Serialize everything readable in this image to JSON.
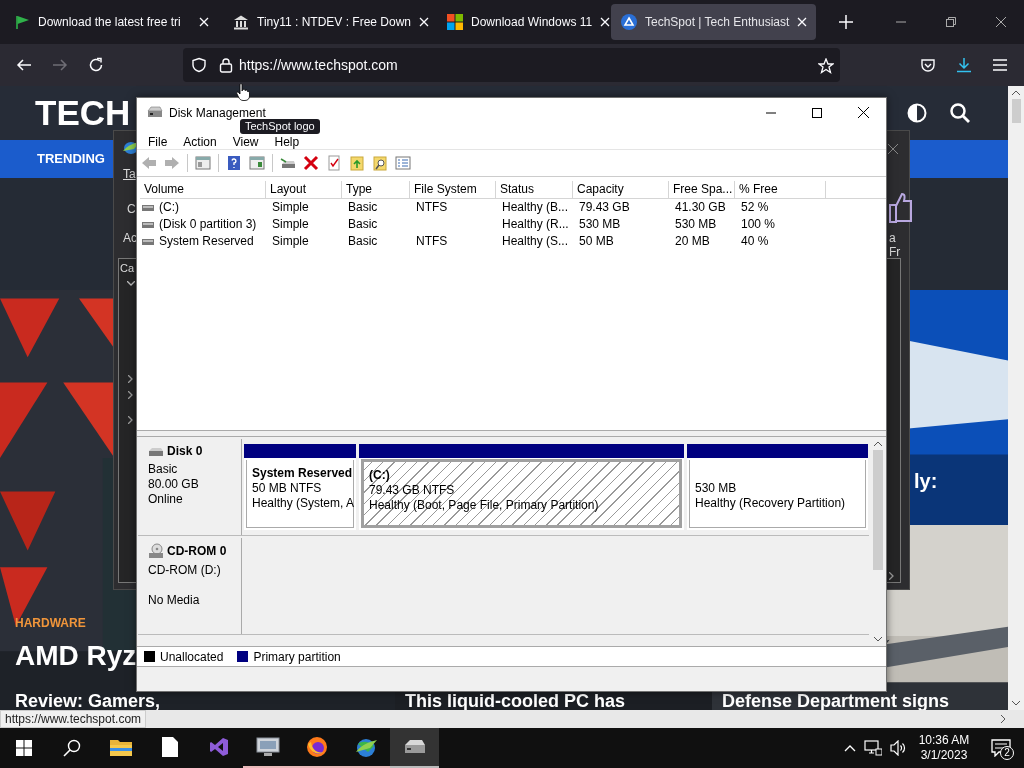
{
  "browser": {
    "tabs": [
      {
        "title": "Download the latest free tri",
        "selected": false
      },
      {
        "title": "Tiny11 : NTDEV : Free Down",
        "selected": false
      },
      {
        "title": "Download Windows 11",
        "selected": false
      },
      {
        "title": "TechSpot | Tech Enthusiast",
        "selected": true
      }
    ],
    "forward_disabled": true,
    "url": "https://www.techspot.com",
    "status_url": "https://www.techspot.com"
  },
  "page": {
    "logo": "TECH",
    "trending": "TRENDING",
    "category": "HARDWARE",
    "lead_headline": [
      "AMD Ryz",
      "Review: Gamers,"
    ],
    "side_headline": "ly:",
    "headlines": [
      "This liquid-cooled PC has",
      "Defense Department signs"
    ]
  },
  "background_dialog": {
    "tab": "Ta",
    "fragments": [
      "C",
      "Ac"
    ],
    "list_header": "Ca",
    "side_text": "a Fr"
  },
  "disk_management": {
    "title": "Disk Management",
    "tooltip": "TechSpot logo",
    "menu": [
      "File",
      "Action",
      "View",
      "Help"
    ],
    "columns": [
      "Volume",
      "Layout",
      "Type",
      "File System",
      "Status",
      "Capacity",
      "Free Spa...",
      "% Free"
    ],
    "volumes": [
      {
        "cells": [
          "(C:)",
          "Simple",
          "Basic",
          "NTFS",
          "Healthy (B...",
          "79.43 GB",
          "41.30 GB",
          "52 %"
        ]
      },
      {
        "cells": [
          "(Disk 0 partition 3)",
          "Simple",
          "Basic",
          "",
          "Healthy (R...",
          "530 MB",
          "530 MB",
          "100 %"
        ]
      },
      {
        "cells": [
          "System Reserved",
          "Simple",
          "Basic",
          "NTFS",
          "Healthy (S...",
          "50 MB",
          "20 MB",
          "40 %"
        ]
      }
    ],
    "disks": [
      {
        "kind": "disk",
        "name": "Disk 0",
        "type": "Basic",
        "size": "80.00 GB",
        "status": "Online",
        "partitions": [
          {
            "name": "System Reserved",
            "size": "50 MB NTFS",
            "status": "Healthy (System, A",
            "selected": false
          },
          {
            "name": "(C:)",
            "size": "79.43 GB NTFS",
            "status": "Healthy (Boot, Page File, Primary Partition)",
            "selected": true
          },
          {
            "size": "530 MB",
            "status": "Healthy (Recovery Partition)",
            "selected": false
          }
        ]
      },
      {
        "kind": "cdrom",
        "name": "CD-ROM 0",
        "type": "CD-ROM (D:)",
        "status": "No Media"
      }
    ],
    "legend": [
      {
        "label": "Unallocated",
        "color": "#000000"
      },
      {
        "label": "Primary partition",
        "color": "#000080"
      }
    ]
  },
  "taskbar": {
    "apps": [
      {
        "running": false,
        "active": false
      },
      {
        "running": false,
        "active": false
      },
      {
        "running": false,
        "active": false
      },
      {
        "running": true,
        "active": false
      },
      {
        "running": true,
        "active": false
      },
      {
        "running": true,
        "active": false
      },
      {
        "running": true,
        "active": true
      }
    ],
    "time": "10:36 AM",
    "date": "3/1/2023",
    "notifications": "2"
  }
}
